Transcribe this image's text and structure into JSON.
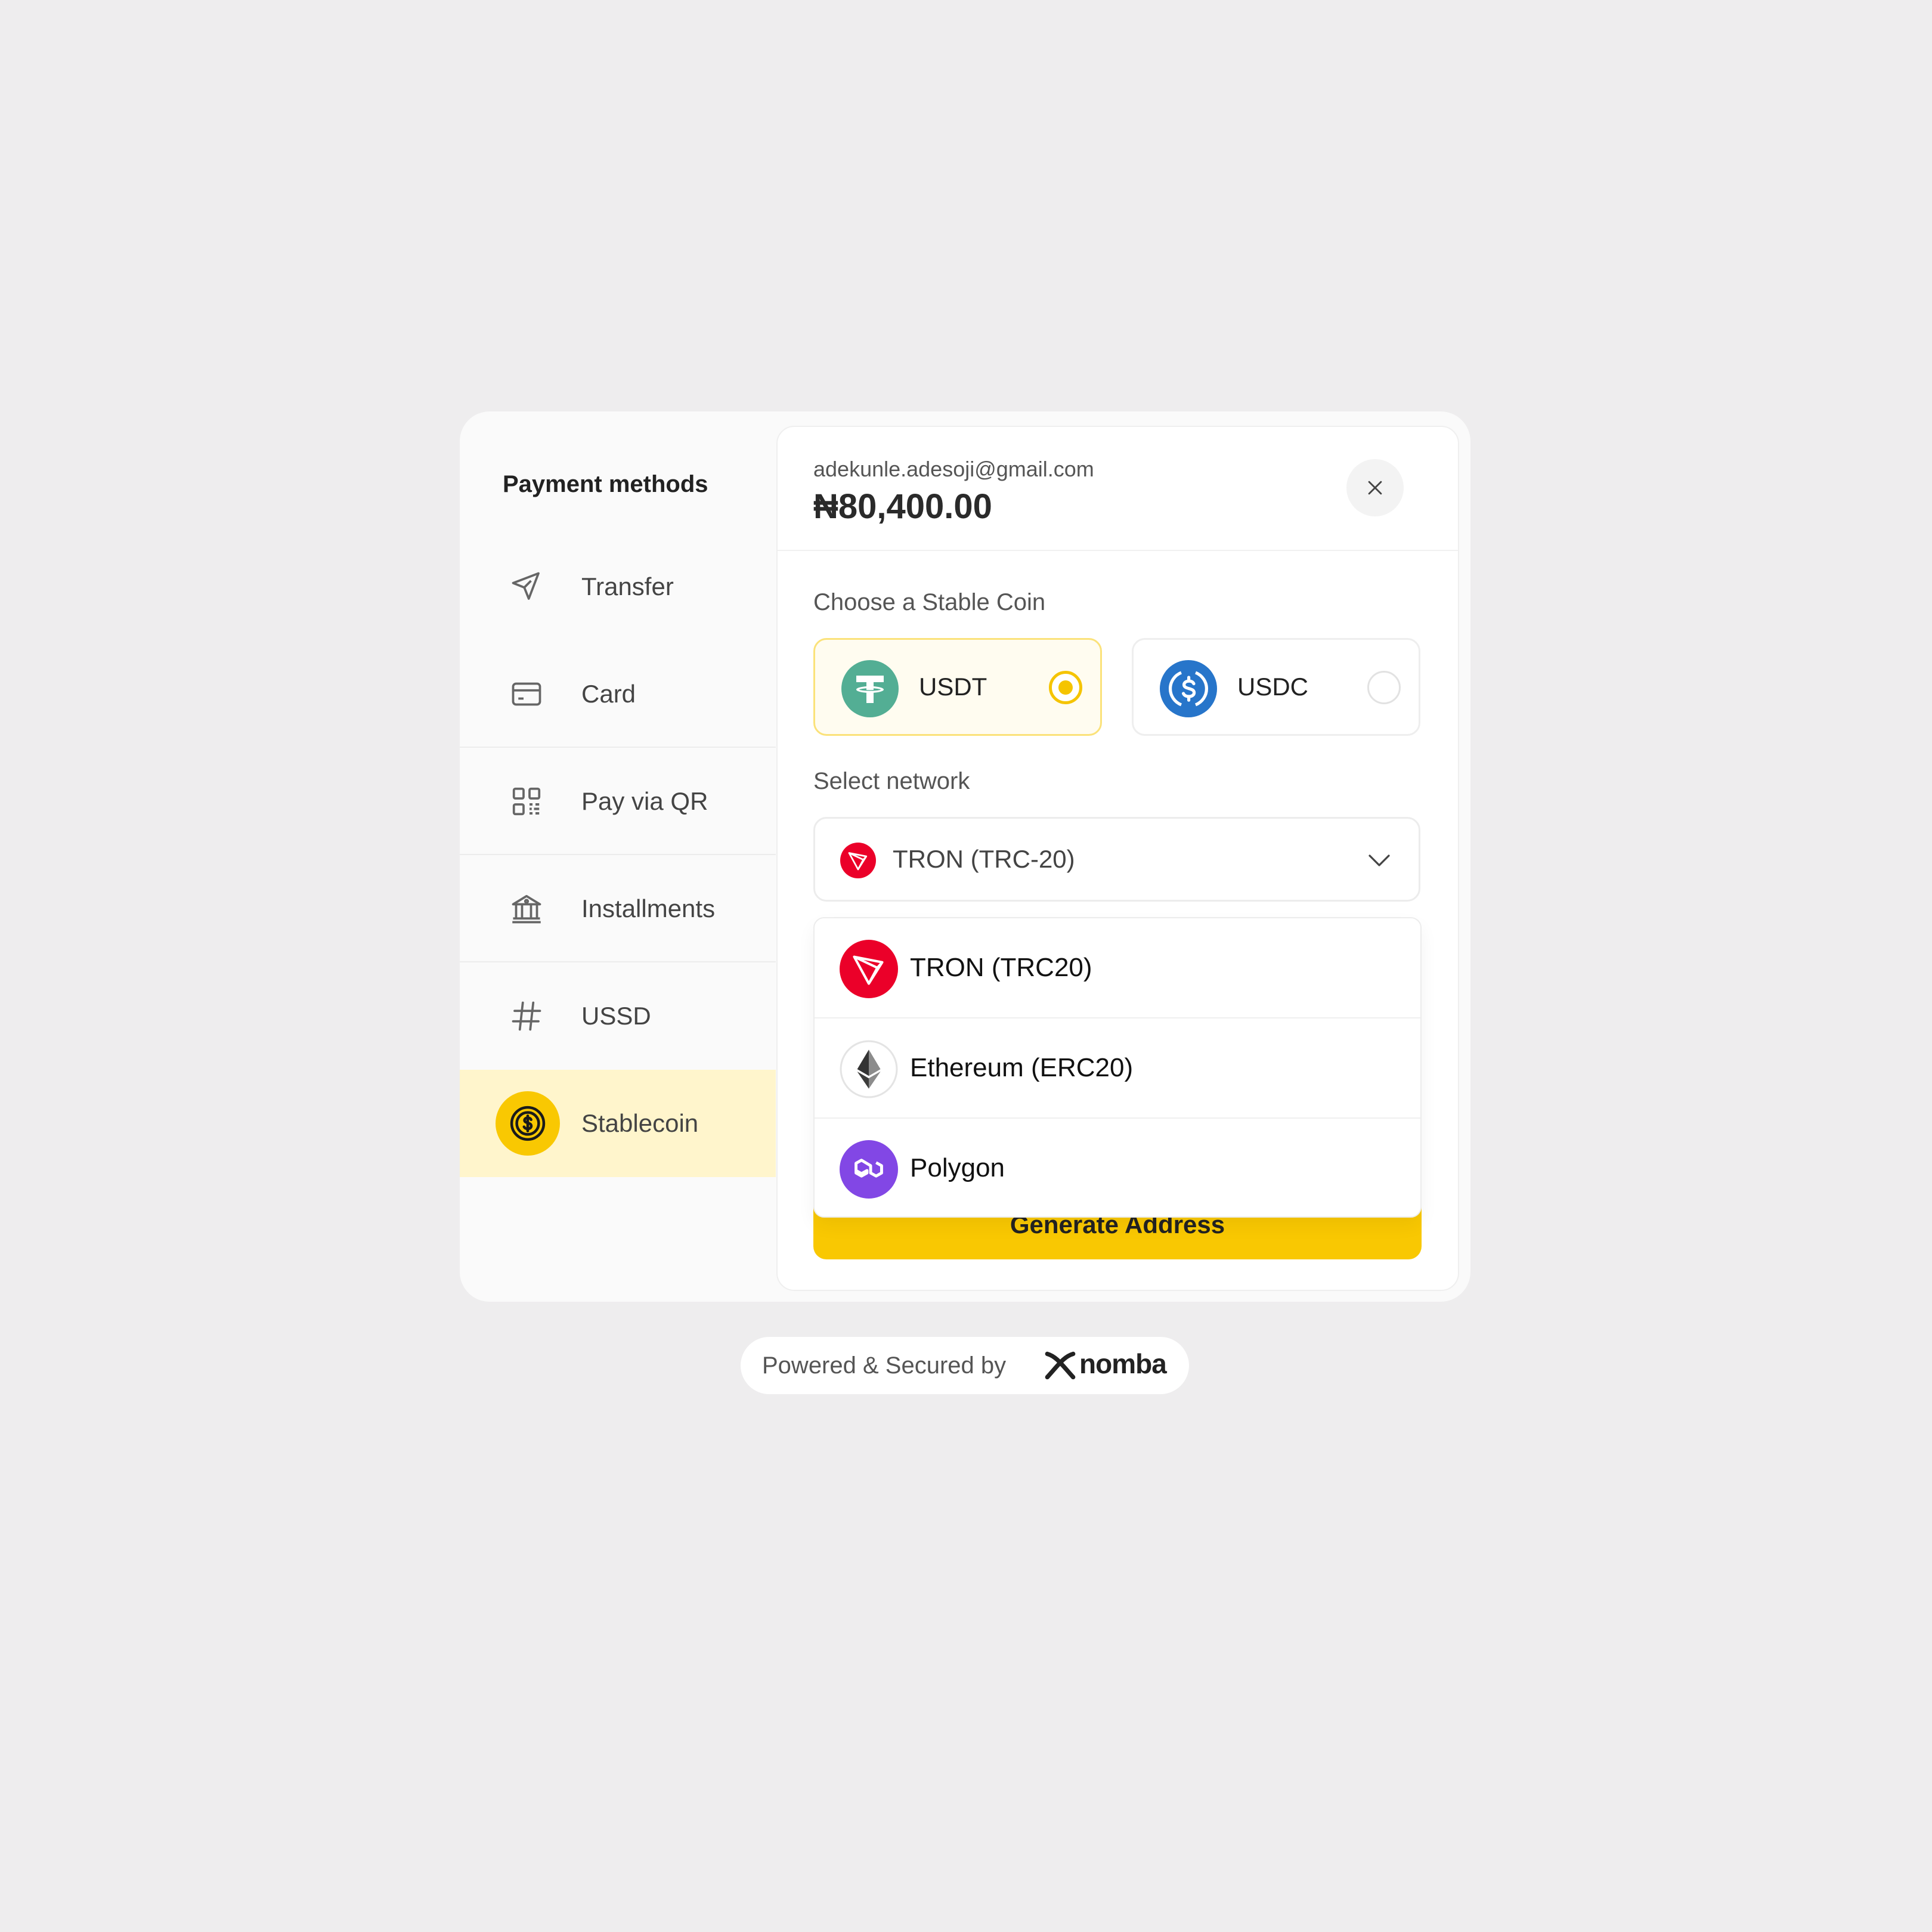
{
  "sidebar": {
    "title": "Payment methods",
    "items": [
      {
        "label": "Transfer",
        "icon": "paper-plane-icon"
      },
      {
        "label": "Card",
        "icon": "credit-card-icon"
      },
      {
        "label": "Pay via QR",
        "icon": "qr-code-icon"
      },
      {
        "label": "Installments",
        "icon": "bank-icon"
      },
      {
        "label": "USSD",
        "icon": "hash-icon"
      },
      {
        "label": "Stablecoin",
        "icon": "dollar-coin-icon",
        "active": true
      }
    ]
  },
  "header": {
    "email": "adekunle.adesoji@gmail.com",
    "amount": "₦80,400.00"
  },
  "coins": {
    "label": "Choose a Stable Coin",
    "options": [
      {
        "label": "USDT",
        "selected": true,
        "color": "#53ae94"
      },
      {
        "label": "USDC",
        "selected": false,
        "color": "#2775ca"
      }
    ]
  },
  "network": {
    "label": "Select network",
    "selected": "TRON (TRC-20)",
    "options": [
      {
        "label": "TRON (TRC20)",
        "color": "#eb0029"
      },
      {
        "label": "Ethereum (ERC20)",
        "color": "#343434"
      },
      {
        "label": "Polygon",
        "color": "#8247e5"
      }
    ]
  },
  "actions": {
    "generate": "Generate Address"
  },
  "footer": {
    "powered": "Powered & Secured by",
    "brand": "nomba"
  },
  "colors": {
    "accent": "#f9c802",
    "accent_light": "#fff5cc"
  }
}
